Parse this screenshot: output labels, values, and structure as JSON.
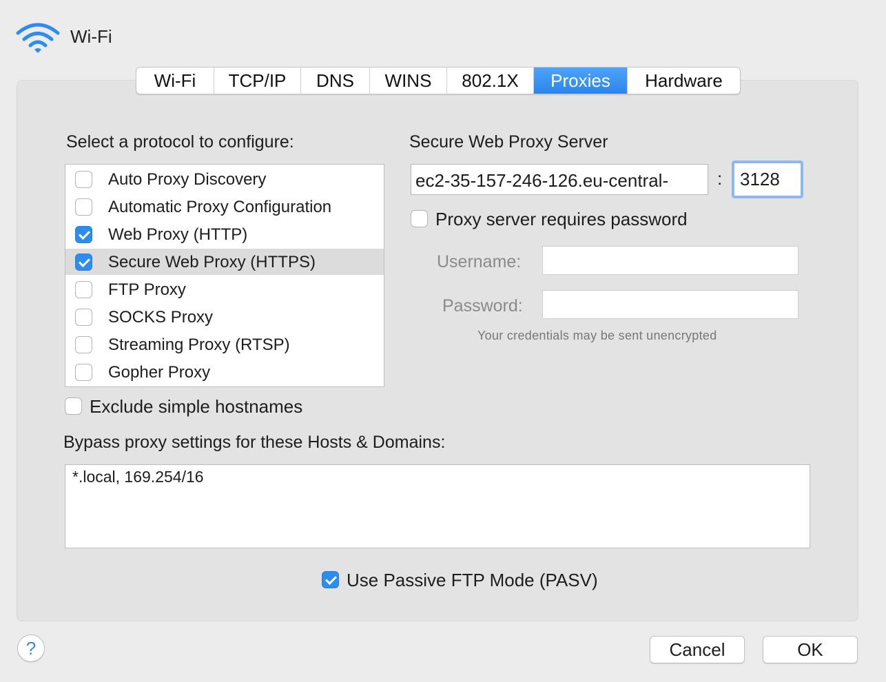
{
  "header": {
    "title": "Wi-Fi",
    "icon": "wifi-icon"
  },
  "tabs": [
    {
      "label": "Wi-Fi",
      "active": false
    },
    {
      "label": "TCP/IP",
      "active": false
    },
    {
      "label": "DNS",
      "active": false
    },
    {
      "label": "WINS",
      "active": false
    },
    {
      "label": "802.1X",
      "active": false
    },
    {
      "label": "Proxies",
      "active": true
    },
    {
      "label": "Hardware",
      "active": false
    }
  ],
  "protocols": {
    "heading": "Select a protocol to configure:",
    "items": [
      {
        "label": "Auto Proxy Discovery",
        "checked": false,
        "selected": false
      },
      {
        "label": "Automatic Proxy Configuration",
        "checked": false,
        "selected": false
      },
      {
        "label": "Web Proxy (HTTP)",
        "checked": true,
        "selected": false
      },
      {
        "label": "Secure Web Proxy (HTTPS)",
        "checked": true,
        "selected": true
      },
      {
        "label": "FTP Proxy",
        "checked": false,
        "selected": false
      },
      {
        "label": "SOCKS Proxy",
        "checked": false,
        "selected": false
      },
      {
        "label": "Streaming Proxy (RTSP)",
        "checked": false,
        "selected": false
      },
      {
        "label": "Gopher Proxy",
        "checked": false,
        "selected": false
      }
    ]
  },
  "server": {
    "heading": "Secure Web Proxy Server",
    "host": "ec2-35-157-246-126.eu-central-",
    "separator": ":",
    "port": "3128",
    "requires_password_label": "Proxy server requires password",
    "requires_password": false,
    "username_label": "Username:",
    "password_label": "Password:",
    "note": "Your credentials may be sent unencrypted"
  },
  "exclude": {
    "label": "Exclude simple hostnames",
    "checked": false
  },
  "bypass": {
    "heading": "Bypass proxy settings for these Hosts & Domains:",
    "value": "*.local, 169.254/16"
  },
  "pasv": {
    "label": "Use Passive FTP Mode (PASV)",
    "checked": true
  },
  "buttons": {
    "help": "?",
    "cancel": "Cancel",
    "ok": "OK"
  },
  "colors": {
    "accent": "#2d8cf0",
    "panel": "#e3e3e3",
    "background": "#ececec"
  }
}
